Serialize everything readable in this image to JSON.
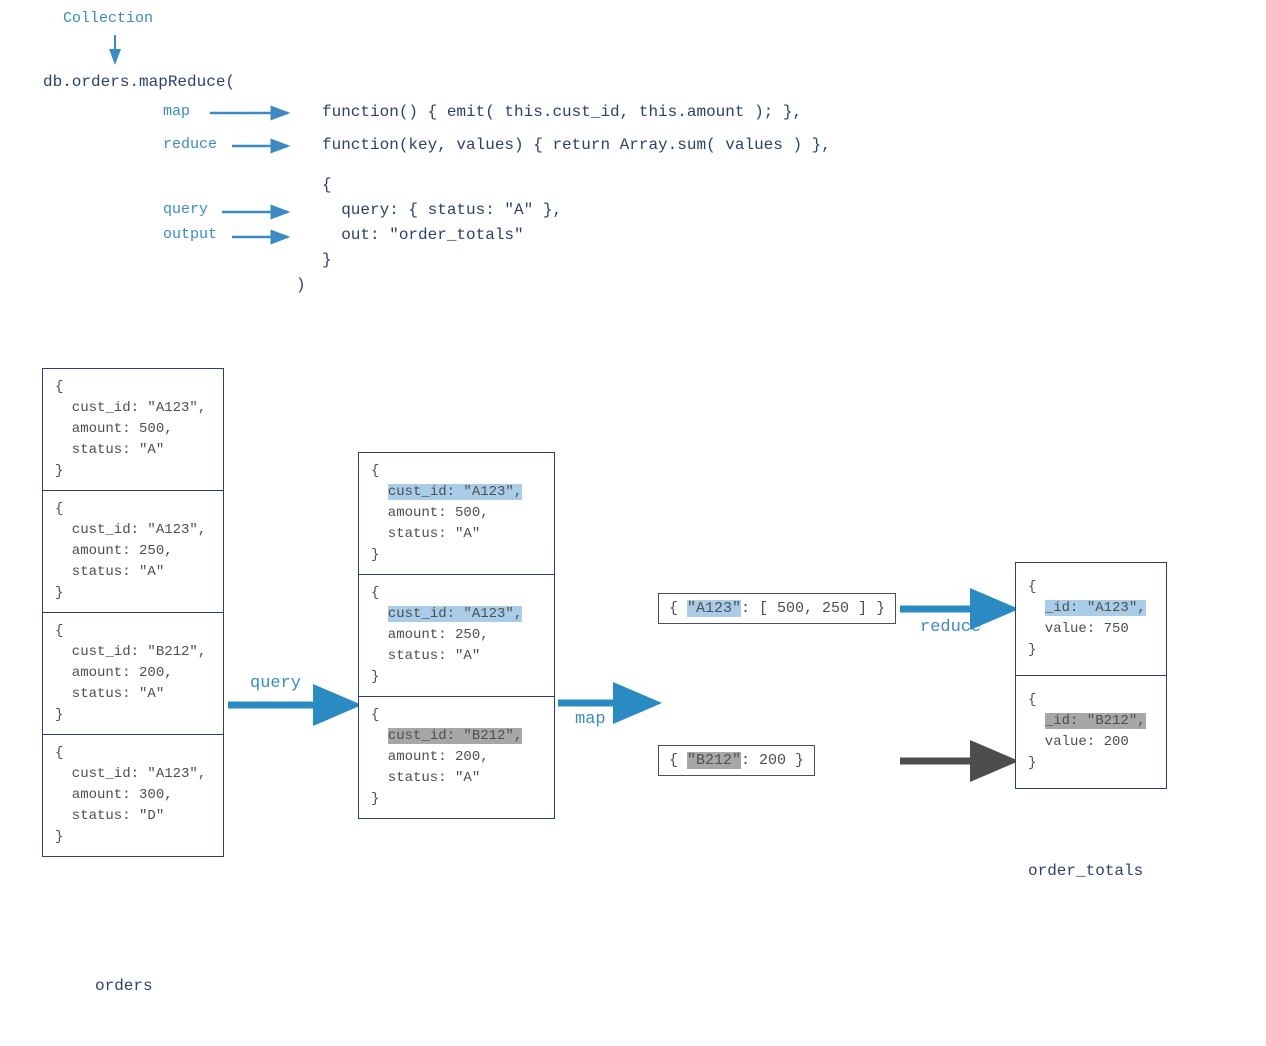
{
  "annotations": {
    "collection": "Collection",
    "map": "map",
    "reduce": "reduce",
    "query_label": "query",
    "output_label": "output",
    "query_arrow": "query",
    "map_arrow": "map",
    "reduce_arrow": "reduce"
  },
  "code": {
    "line1": "db.orders.mapReduce(",
    "map_fn": "function() { emit( this.cust_id, this.amount ); },",
    "reduce_fn": "function(key, values) { return Array.sum( values ) },",
    "brace_open": "{",
    "query_line": "  query: { status: \"A\" },",
    "out_line": "  out: \"order_totals\"",
    "brace_close": "}",
    "paren_close": ")"
  },
  "orders_label": "orders",
  "orders": [
    {
      "l1": "{",
      "l2": "  cust_id: \"A123\",",
      "l3": "  amount: 500,",
      "l4": "  status: \"A\"",
      "l5": "}"
    },
    {
      "l1": "{",
      "l2": "  cust_id: \"A123\",",
      "l3": "  amount: 250,",
      "l4": "  status: \"A\"",
      "l5": "}"
    },
    {
      "l1": "{",
      "l2": "  cust_id: \"B212\",",
      "l3": "  amount: 200,",
      "l4": "  status: \"A\"",
      "l5": "}"
    },
    {
      "l1": "{",
      "l2": "  cust_id: \"A123\",",
      "l3": "  amount: 300,",
      "l4": "  status: \"D\"",
      "l5": "}"
    }
  ],
  "queried": [
    {
      "l1": "{",
      "pre": "  ",
      "hl": "cust_id: \"A123\",",
      "l3": "  amount: 500,",
      "l4": "  status: \"A\"",
      "l5": "}",
      "cls": "hl-blue"
    },
    {
      "l1": "{",
      "pre": "  ",
      "hl": "cust_id: \"A123\",",
      "l3": "  amount: 250,",
      "l4": "  status: \"A\"",
      "l5": "}",
      "cls": "hl-blue"
    },
    {
      "l1": "{",
      "pre": "  ",
      "hl": "cust_id: \"B212\",",
      "l3": "  amount: 200,",
      "l4": "  status: \"A\"",
      "l5": "}",
      "cls": "hl-grey"
    }
  ],
  "mapped": {
    "a": {
      "open": "{ ",
      "key": "\"A123\"",
      "rest": ": [ 500, 250 ]",
      "close": " }"
    },
    "b": {
      "open": "{ ",
      "key": "\"B212\"",
      "rest": ": 200",
      "close": " }"
    }
  },
  "order_totals_label": "order_totals",
  "results": [
    {
      "l1": "{",
      "pre": "  ",
      "hl": "_id: \"A123\",",
      "l3": "  value: 750",
      "l5": "}",
      "cls": "hl-blue"
    },
    {
      "l1": "{",
      "pre": "  ",
      "hl": "_id: \"B212\",",
      "l3": "  value: 200",
      "l5": "}",
      "cls": "hl-grey"
    }
  ]
}
